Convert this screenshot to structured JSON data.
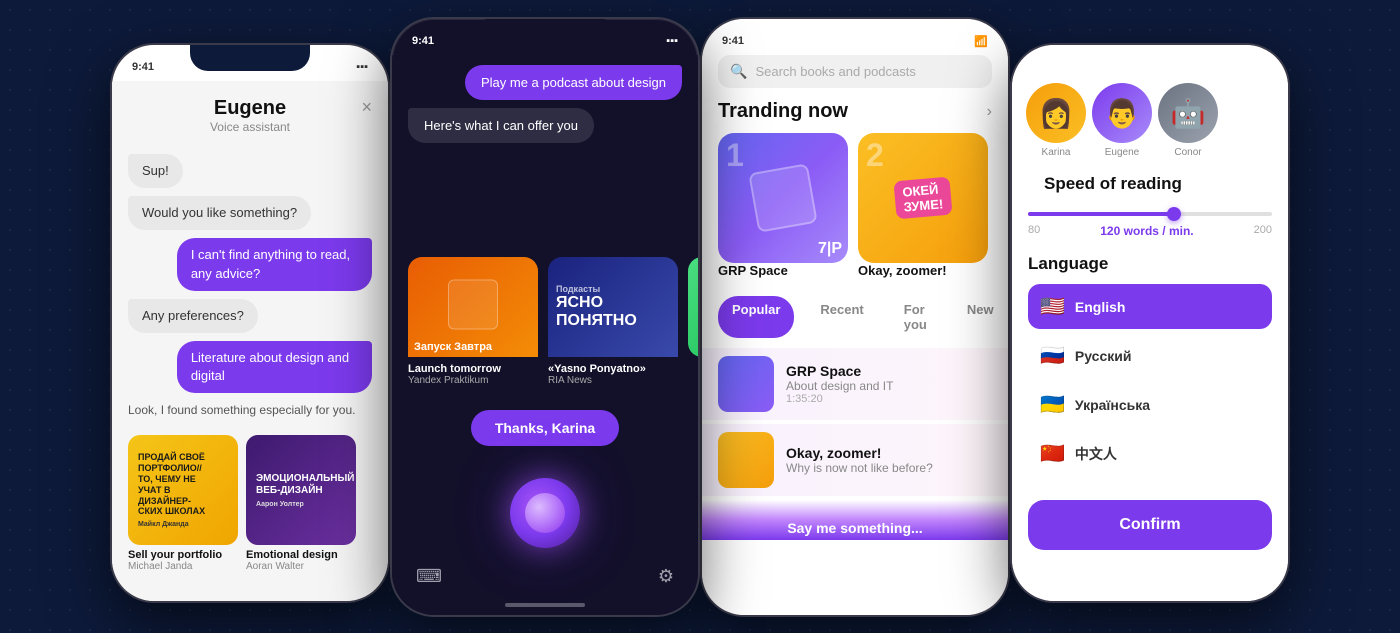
{
  "app": {
    "background": "#0d1a3a"
  },
  "phone1": {
    "status_time": "9:41",
    "assistant_name": "Eugene",
    "assistant_sub": "Voice assistant",
    "close_label": "×",
    "messages": [
      {
        "type": "system",
        "text": "Sup!"
      },
      {
        "type": "system",
        "text": "Would you like something?"
      },
      {
        "type": "user",
        "text": "I can't find anything to read, any advice?"
      },
      {
        "type": "system",
        "text": "Any preferences?"
      },
      {
        "type": "user",
        "text": "Literature about design and digital"
      }
    ],
    "system_response": "Look, I found something especially for you.",
    "book1_title": "Sell your portfolio",
    "book1_author": "Michael Janda",
    "book1_cover_text": "ПРОДАЙ СВОЁ ПОРТФОЛИО// ТО, ЧЕМУ НЕ УЧАТ В ДИЗАЙНЕР- СКИХ ШКОЛАХ",
    "book1_author_ru": "Майкл Джанда",
    "book2_title": "Emotional design",
    "book2_author": "Aoran Walter",
    "book2_cover_text": "ЭМОЦИОНАЛЬНЫЙ ВЕБ-ДИЗАЙН"
  },
  "phone2": {
    "status_time": "9:41",
    "user_message": "Play me a podcast about design",
    "system_response": "Here's what I can offer you",
    "card1_label": "Запуск Завтра",
    "card1_title": "Launch tomorrow",
    "card1_sub": "Yandex Praktikum",
    "card2_label": "Подкасты ЯСНО ПОНЯТНО",
    "card2_title": "«Yasno Ponyatno»",
    "card2_sub": "RIA News",
    "thanks_button": "Thanks, Karina"
  },
  "phone3": {
    "status_time": "9:41",
    "search_placeholder": "Search books and podcasts",
    "trending_title": "Tranding now",
    "trending_arrow": "›",
    "card1_name": "GRP Space",
    "card2_name": "Okay, zoomer!",
    "tabs": [
      "Popular",
      "Recent",
      "For you",
      "New"
    ],
    "active_tab": "Popular",
    "list_item1_title": "GRP Space",
    "list_item1_sub": "About design and IT",
    "list_item1_time": "1:35:20",
    "list_item2_title": "Okay, zoomer!",
    "list_item2_sub": "Why is now not like before?",
    "gradient_text": "Say me something..."
  },
  "phone4": {
    "avatar1_name": "Karina",
    "avatar2_name": "Eugene",
    "avatar3_name": "Conor",
    "speed_title": "Speed of reading",
    "speed_min": "80",
    "speed_value": "120 words / min.",
    "speed_max": "200",
    "language_title": "Language",
    "languages": [
      {
        "flag": "🇺🇸",
        "name": "English",
        "active": true
      },
      {
        "flag": "🇷🇺",
        "name": "Русский",
        "active": false
      },
      {
        "flag": "🇺🇦",
        "name": "Українська",
        "active": false
      },
      {
        "flag": "🇨🇳",
        "name": "中文人",
        "active": false
      }
    ],
    "confirm_label": "Confirm"
  }
}
